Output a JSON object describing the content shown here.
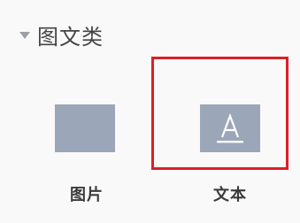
{
  "section": {
    "title": "图文类",
    "expanded_icon": "caret-down-icon"
  },
  "tiles": [
    {
      "label": "图片",
      "icon": "image-placeholder-icon"
    },
    {
      "label": "文本",
      "icon": "text-a-icon"
    }
  ],
  "highlight": {
    "target": "文本",
    "color": "#dd1f26"
  },
  "colors": {
    "thumbnail": "#9ba6b8",
    "background": "#f9f9fa"
  }
}
